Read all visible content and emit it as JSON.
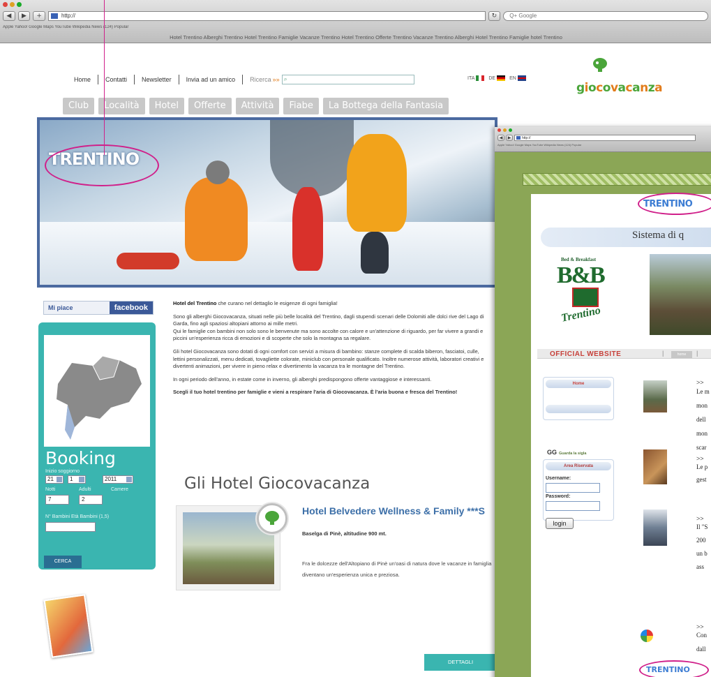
{
  "browser": {
    "url": "http://",
    "search_placeholder": "Q+ Google",
    "bookmarks": "Apple   Yahoo!   Google Maps   YouTube   Wikipedia   News (124)   Popular"
  },
  "site": {
    "tagline": "Hotel Trentino Alberghi Trentino Hotel Trentino  Famiglie Vacanze Trentino Hotel Trentino Offerte Trentino Vacanze Trentino Alberghi Hotel Trentino Famiglie hotel Trentino",
    "topnav": [
      "Home",
      "Contatti",
      "Newsletter",
      "Invia ad un amico"
    ],
    "search_label": "Ricerca",
    "search_arrow": "»»",
    "languages": [
      "ITA",
      "DE",
      "EN"
    ],
    "brand": "giocovacanza",
    "menu": [
      "Club",
      "Località",
      "Hotel",
      "Offerte",
      "Attività",
      "Fiabe",
      "La Bottega della Fantasia"
    ],
    "hero_logo": "TRENTINO",
    "facebook": {
      "like": "Mi piace",
      "name": "facebook"
    },
    "booking": {
      "title": "Booking",
      "inizio_label": "Inizio soggiorno",
      "day": "21",
      "month": "1",
      "year": "2011",
      "notti_label": "Notti",
      "adulti_label": "Adulti",
      "camere_label": "Camere",
      "notti_value": "7",
      "adulti_value": "2",
      "bambini_label": "N° Bambini Età Bambini (1,5)",
      "cerca": "CERCA"
    },
    "intro": {
      "p1a": "Hotel del Trentino",
      "p1b": " che curano nel dettaglio le esigenze di ogni famiglia!",
      "p2": "Sono gli alberghi Giocovacanza, situati nelle più belle località del Trentino, dagli stupendi scenari delle Dolomiti alle dolci rive del Lago di Garda, fino agli spaziosi altopiani attorno ai mille metri.",
      "p3": "Qui le famiglie con bambini non solo sono le benvenute ma sono accolte con calore e un'attenzione di riguardo, per far vivere a grandi e piccini un'esperienza ricca di emozioni e di scoperte che solo la montagna sa regalare.",
      "p4": "Gli hotel Giocovacanza sono dotati di ogni comfort con servizi a misura di bambino: stanze complete di scalda biberon, fasciatoi, culle, lettini personalizzati, menu dedicati, tovagliette colorate, miniclub con personale qualificato. Inoltre numerose attività, laboratori creativi e divertenti animazioni, per vivere in pieno relax e divertimento la vacanza tra le montagne del Trentino.",
      "p5": "In ogni periodo dell'anno, in estate come in inverno, gli alberghi predispongono offerte vantaggiose e interessanti.",
      "p6": "Scegli il tuo hotel trentino per famiglie e vieni a respirare l'aria di Giocovacanza. È l'aria buona e fresca del Trentino!"
    },
    "hotels_heading": "Gli Hotel Giocovacanza",
    "hotel": {
      "name": "Hotel Belvedere Wellness & Family ***S",
      "location": "Baselga di Pinè, altitudine 900 mt.",
      "description": "Fra le dolcezze dell'Altopiano di Pinè un'oasi di natura dove le vacanze in famiglia diventano un'esperienza unica e preziosa.",
      "button": "DETTAGLI"
    }
  },
  "site2": {
    "logo": "TRENTINO",
    "logo_bottom": "TRENTINO",
    "title": "Sistema di q",
    "bb_small": "Bed & Breakfast",
    "bb_big": "B&B",
    "bb_script": "Trentino",
    "official": "OFFICIAL WEBSITE",
    "separator": "|",
    "home": "home",
    "guarda": "Guarda la sigla",
    "gg": "GG",
    "area": "Area Riservata",
    "username": "Username:",
    "password": "Password:",
    "login": "login",
    "news_marker": ">>",
    "news": [
      [
        "Le m",
        "mon",
        "dell",
        "mon",
        "scar"
      ],
      [
        "Le p",
        "gest"
      ],
      [
        "Il \"S",
        "200",
        "un b",
        "ass"
      ],
      [
        "Con",
        "dall"
      ]
    ]
  },
  "colors": {
    "teal": "#3ab5b0",
    "hero_border": "#4b6aa0",
    "highlight": "#d0208a",
    "green": "#8ba656"
  }
}
